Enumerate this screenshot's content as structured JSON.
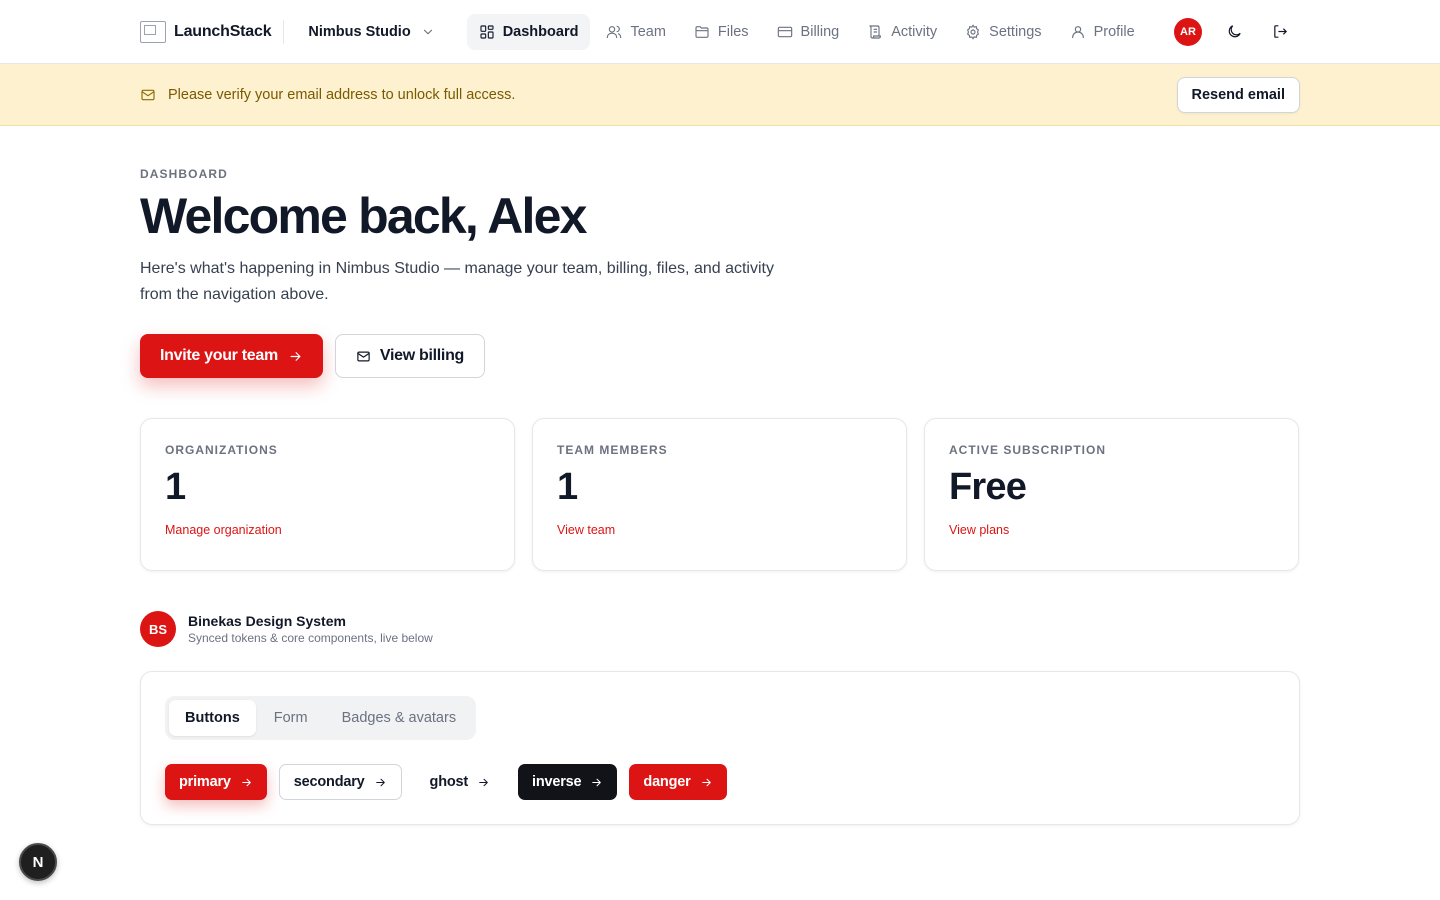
{
  "brand": {
    "name": "LaunchStack"
  },
  "org_switcher": {
    "name": "Nimbus Studio"
  },
  "nav": {
    "items": [
      {
        "label": "Dashboard",
        "icon": "dashboard-icon",
        "active": true
      },
      {
        "label": "Team",
        "icon": "users-icon"
      },
      {
        "label": "Files",
        "icon": "folder-icon"
      },
      {
        "label": "Billing",
        "icon": "credit-card-icon"
      },
      {
        "label": "Activity",
        "icon": "scroll-icon"
      },
      {
        "label": "Settings",
        "icon": "gear-icon"
      },
      {
        "label": "Profile",
        "icon": "user-icon"
      }
    ],
    "user_initials": "AR"
  },
  "banner": {
    "message": "Please verify your email address to unlock full access.",
    "button_label": "Resend email"
  },
  "hero": {
    "eyebrow": "DASHBOARD",
    "title": "Welcome back, Alex",
    "subtitle": "Here's what's happening in Nimbus Studio — manage your team, billing, files, and activity from the navigation above.",
    "primary_cta": "Invite your team",
    "secondary_cta": "View billing"
  },
  "stats": [
    {
      "label": "ORGANIZATIONS",
      "value": "1",
      "link": "Manage organization"
    },
    {
      "label": "TEAM MEMBERS",
      "value": "1",
      "link": "View team"
    },
    {
      "label": "ACTIVE SUBSCRIPTION",
      "value": "Free",
      "link": "View plans"
    }
  ],
  "design_system": {
    "initials": "BS",
    "title": "Binekas Design System",
    "subtitle": "Synced tokens & core components, live below",
    "tabs": [
      "Buttons",
      "Form",
      "Badges & avatars"
    ],
    "active_tab": "Buttons",
    "buttons": [
      "primary",
      "secondary",
      "ghost",
      "inverse",
      "danger"
    ]
  },
  "dev_badge": {
    "letter": "N"
  },
  "colors": {
    "accent": "#dc1414",
    "banner_bg": "#fdf1cf",
    "inverse": "#111318"
  }
}
